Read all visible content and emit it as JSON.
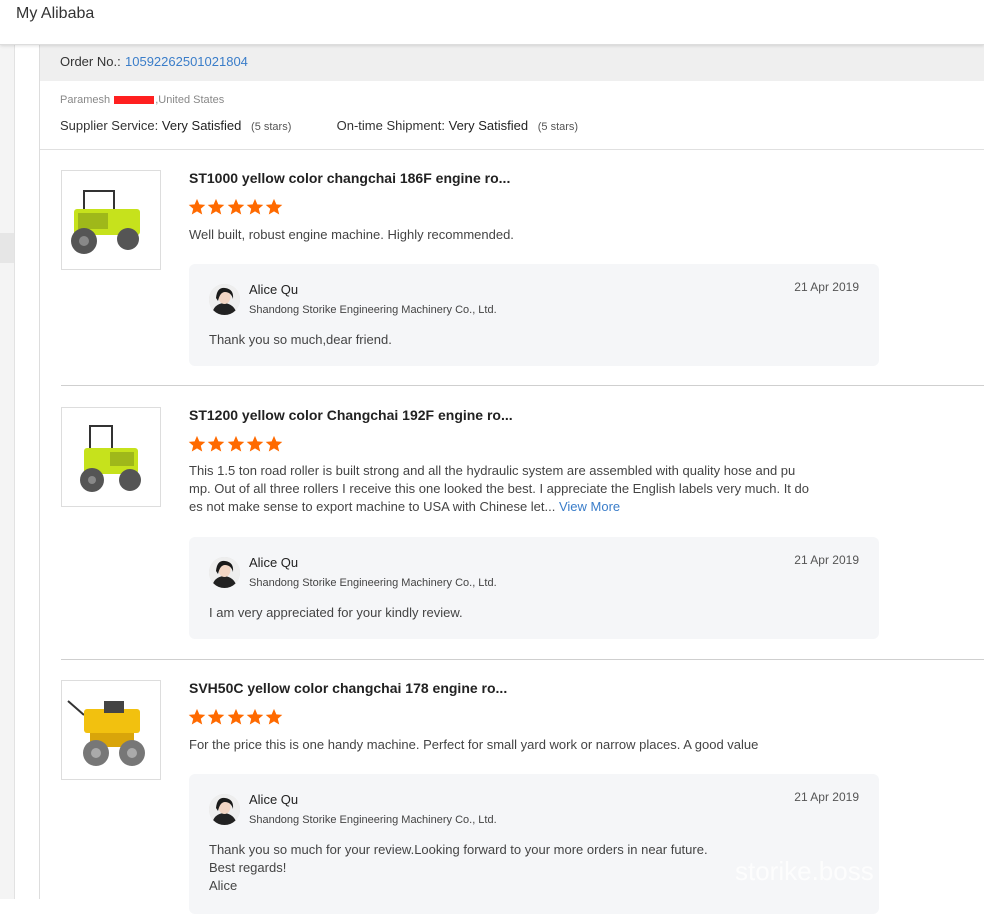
{
  "header": {
    "title": "My Alibaba"
  },
  "order": {
    "label": "Order No.:",
    "number": "1059226250102180​4"
  },
  "buyer": {
    "name_prefix": "Paramesh ",
    "name_suffix": ",United States"
  },
  "ratings": {
    "supplier_label": "Supplier Service:",
    "supplier_value": "Very Satisfied",
    "supplier_stars": "(5 stars)",
    "shipment_label": "On-time Shipment:",
    "shipment_value": "Very Satisfied",
    "shipment_stars": "(5 stars)"
  },
  "colors": {
    "accent": "#3a7dc9",
    "star": "#ff6a00",
    "machine_yellow": "#c6e21c"
  },
  "reviews": [
    {
      "title": "ST1000 yellow color changchai 186F engine ro...",
      "stars": 5,
      "text": "Well built, robust engine machine. Highly recommended.",
      "view_more": "",
      "reply": {
        "name": "Alice Qu",
        "company": "Shandong Storike Engineering Machinery Co., Ltd.",
        "date": "21 Apr 2019",
        "lines": [
          "Thank you so much,dear friend."
        ]
      }
    },
    {
      "title": "ST1200 yellow color Changchai 192F engine ro...",
      "stars": 5,
      "text_lines": [
        "This 1.5 ton road roller is built strong and all the hydraulic system are assembled with quality hose and pu",
        "mp. Out of all three rollers I receive this one looked the best. I appreciate the English labels very much. It do",
        "es not make sense to export machine to USA with Chinese let..."
      ],
      "view_more": "View More",
      "reply": {
        "name": "Alice Qu",
        "company": "Shandong Storike Engineering Machinery Co., Ltd.",
        "date": "21 Apr 2019",
        "lines": [
          "I am very appreciated for your kindly review."
        ]
      }
    },
    {
      "title": "SVH50C yellow color changchai 178 engine ro...",
      "stars": 5,
      "text": "For the price this is one handy machine. Perfect for small yard work or narrow places. A good value",
      "view_more": "",
      "reply": {
        "name": "Alice Qu",
        "company": "Shandong Storike Engineering Machinery Co., Ltd.",
        "date": "21 Apr 2019",
        "lines": [
          "Thank you so much for your review.Looking forward to your more orders in near future.",
          "Best regards!",
          "Alice"
        ]
      }
    }
  ],
  "watermark": "storike.boss"
}
